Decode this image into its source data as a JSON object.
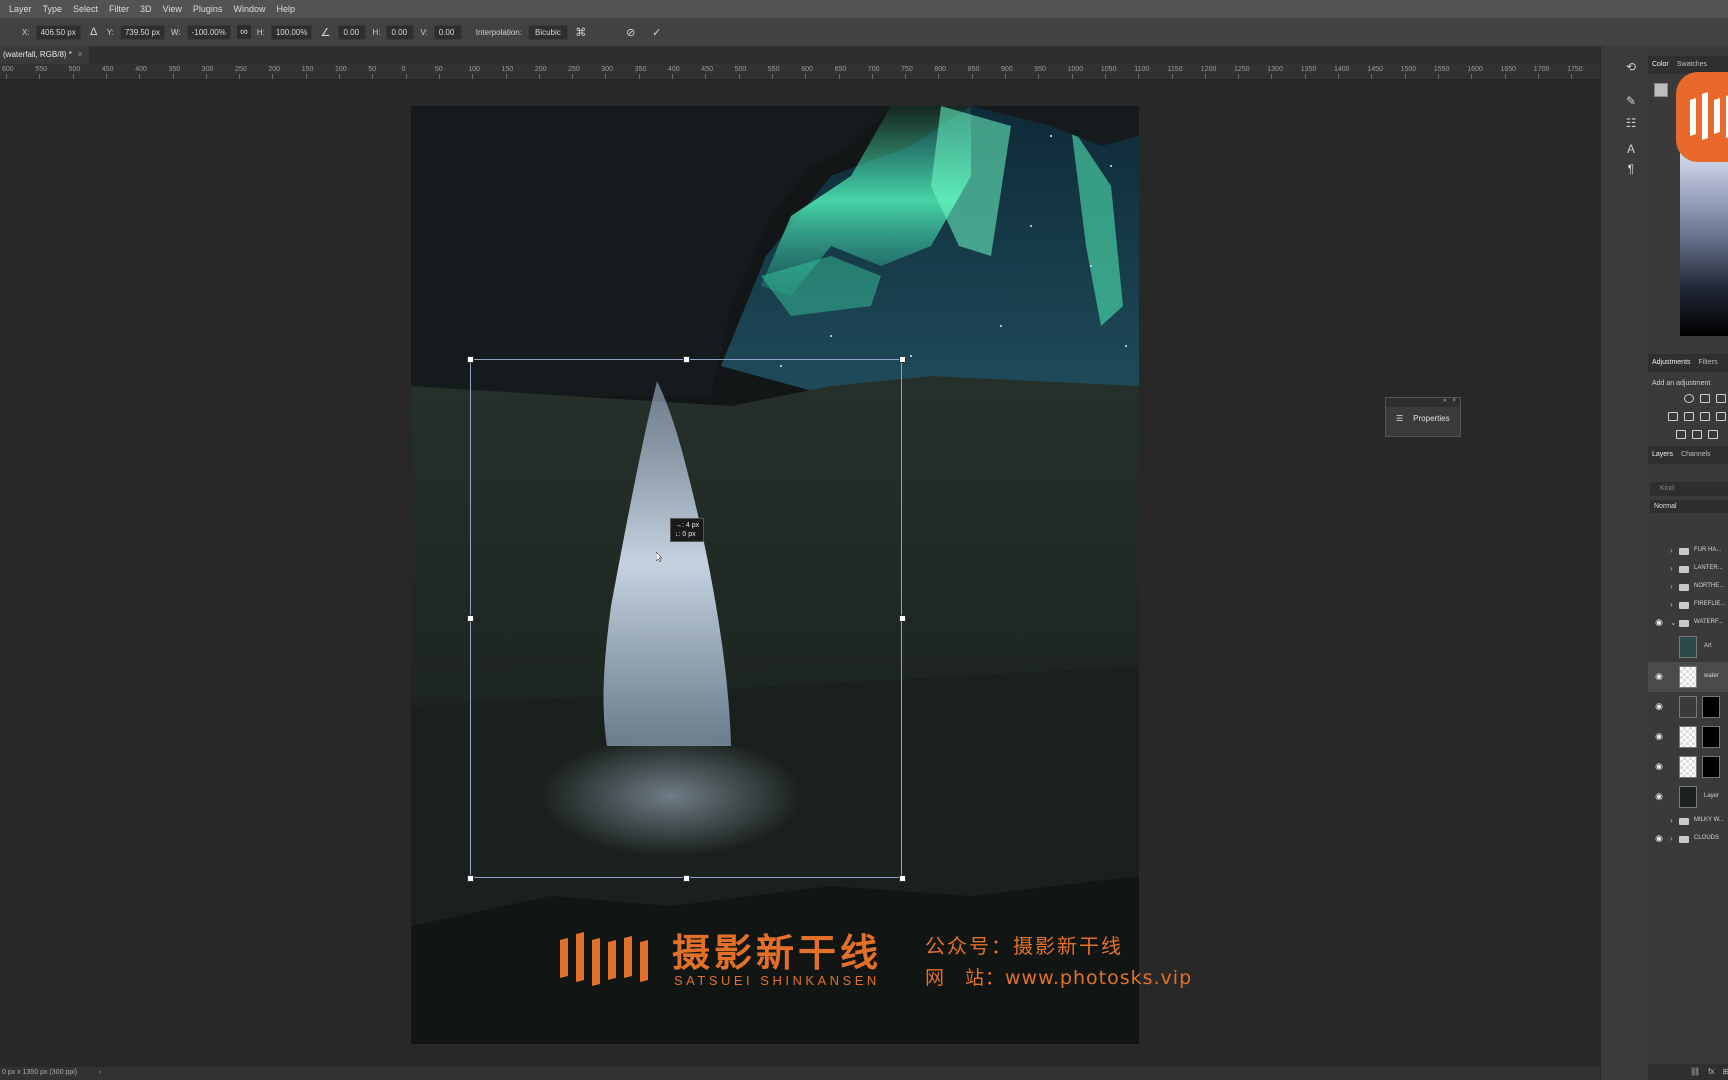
{
  "menubar": {
    "items": [
      "Layer",
      "Type",
      "Select",
      "Filter",
      "3D",
      "View",
      "Plugins",
      "Window",
      "Help"
    ]
  },
  "options": {
    "x_label": "X:",
    "x_value": "406.50 px",
    "y_label": "Y:",
    "y_value": "739.50 px",
    "w_label": "W:",
    "w_value": "-100.00%",
    "h_label": "H:",
    "h_value": "100.00%",
    "angle_value": "0.00",
    "hskew_label": "H:",
    "hskew_value": "0.00",
    "vskew_label": "V:",
    "vskew_value": "0.00",
    "interp_label": "Interpolation:",
    "interp_value": "Bicubic"
  },
  "document": {
    "tab_title": "(waterfall, RGB/8) *",
    "close": "×"
  },
  "ruler": {
    "labels": [
      "600",
      "550",
      "500",
      "450",
      "400",
      "350",
      "300",
      "250",
      "200",
      "150",
      "100",
      "50",
      "0",
      "50",
      "100",
      "150",
      "200",
      "250",
      "300",
      "350",
      "400",
      "450",
      "500",
      "550",
      "600",
      "650",
      "700",
      "750",
      "800",
      "850",
      "900",
      "950",
      "1000",
      "1050",
      "1100",
      "1150",
      "1200",
      "1250",
      "1300",
      "1350",
      "1400",
      "1450",
      "1500",
      "1550",
      "1600",
      "1650",
      "1700",
      "1750"
    ]
  },
  "transform": {
    "tooltip_line1": "→: 4 px",
    "tooltip_line2": "↓: 0 px"
  },
  "properties_panel": {
    "label": "Properties",
    "collapse": "»",
    "close": "×"
  },
  "watermark": {
    "cn_title": "摄影新干线",
    "en_title": "SATSUEI SHINKANSEN",
    "line1": "公众号：摄影新干线",
    "line2": "网　站：www.photosks.vip"
  },
  "status": {
    "doc_info": "0 px x 1350 px (300 ppi)",
    "arrow": "›"
  },
  "right_panel": {
    "color_tabs": [
      "Color",
      "Swatches"
    ],
    "adjust_tabs": [
      "Adjustments",
      "Filters"
    ],
    "adjust_hint": "Add an adjustment",
    "layer_tabs": [
      "Layers",
      "Channels"
    ],
    "search_placeholder": "Kind",
    "blend_mode": "Normal",
    "layers": [
      {
        "name": "FUR HA...",
        "kind": "group",
        "visible": false
      },
      {
        "name": "LANTER...",
        "kind": "group",
        "visible": false
      },
      {
        "name": "NORTHE...",
        "kind": "group",
        "visible": false
      },
      {
        "name": "FIREFLIE...",
        "kind": "group",
        "visible": false
      },
      {
        "name": "WATERF...",
        "kind": "group-open",
        "visible": true
      },
      {
        "name": "Art",
        "kind": "smart",
        "visible": false
      },
      {
        "name": "water",
        "kind": "pixel",
        "visible": true
      },
      {
        "name": "",
        "kind": "adjustment",
        "visible": true
      },
      {
        "name": "",
        "kind": "masked",
        "visible": true
      },
      {
        "name": "",
        "kind": "masked",
        "visible": true
      },
      {
        "name": "Layer",
        "kind": "pixel-dark",
        "visible": true
      },
      {
        "name": "MILKY W...",
        "kind": "group",
        "visible": false
      },
      {
        "name": "CLOUDS",
        "kind": "group",
        "visible": true
      }
    ]
  },
  "colors": {
    "accent": "#e3702a",
    "canvas_bg": "#282828",
    "panel_bg": "#3a3a3a",
    "aurora": "#3fd8a8"
  }
}
